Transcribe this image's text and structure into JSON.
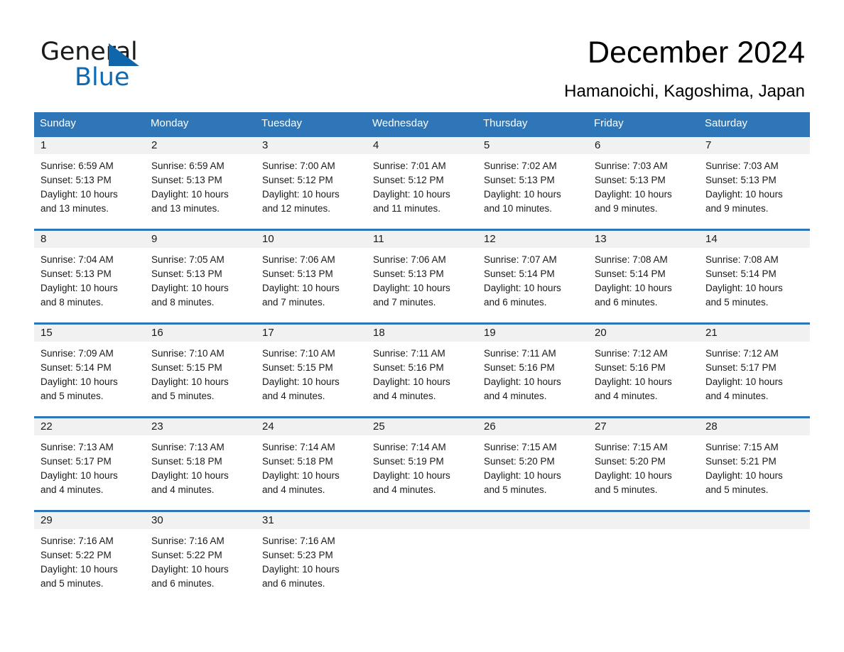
{
  "brand": {
    "word1": "General",
    "word2": "Blue",
    "triangle_color": "#1066ab",
    "blue_text_color": "#0d6ab5"
  },
  "header": {
    "title": "December 2024",
    "subtitle": "Hamanoichi, Kagoshima, Japan",
    "header_bg": "#2e76b8",
    "day_band_bg": "#f1f1f1"
  },
  "weekdays": [
    "Sunday",
    "Monday",
    "Tuesday",
    "Wednesday",
    "Thursday",
    "Friday",
    "Saturday"
  ],
  "weeks": [
    [
      {
        "day": "1",
        "sunrise": "Sunrise: 6:59 AM",
        "sunset": "Sunset: 5:13 PM",
        "daylight1": "Daylight: 10 hours",
        "daylight2": "and 13 minutes."
      },
      {
        "day": "2",
        "sunrise": "Sunrise: 6:59 AM",
        "sunset": "Sunset: 5:13 PM",
        "daylight1": "Daylight: 10 hours",
        "daylight2": "and 13 minutes."
      },
      {
        "day": "3",
        "sunrise": "Sunrise: 7:00 AM",
        "sunset": "Sunset: 5:12 PM",
        "daylight1": "Daylight: 10 hours",
        "daylight2": "and 12 minutes."
      },
      {
        "day": "4",
        "sunrise": "Sunrise: 7:01 AM",
        "sunset": "Sunset: 5:12 PM",
        "daylight1": "Daylight: 10 hours",
        "daylight2": "and 11 minutes."
      },
      {
        "day": "5",
        "sunrise": "Sunrise: 7:02 AM",
        "sunset": "Sunset: 5:13 PM",
        "daylight1": "Daylight: 10 hours",
        "daylight2": "and 10 minutes."
      },
      {
        "day": "6",
        "sunrise": "Sunrise: 7:03 AM",
        "sunset": "Sunset: 5:13 PM",
        "daylight1": "Daylight: 10 hours",
        "daylight2": "and 9 minutes."
      },
      {
        "day": "7",
        "sunrise": "Sunrise: 7:03 AM",
        "sunset": "Sunset: 5:13 PM",
        "daylight1": "Daylight: 10 hours",
        "daylight2": "and 9 minutes."
      }
    ],
    [
      {
        "day": "8",
        "sunrise": "Sunrise: 7:04 AM",
        "sunset": "Sunset: 5:13 PM",
        "daylight1": "Daylight: 10 hours",
        "daylight2": "and 8 minutes."
      },
      {
        "day": "9",
        "sunrise": "Sunrise: 7:05 AM",
        "sunset": "Sunset: 5:13 PM",
        "daylight1": "Daylight: 10 hours",
        "daylight2": "and 8 minutes."
      },
      {
        "day": "10",
        "sunrise": "Sunrise: 7:06 AM",
        "sunset": "Sunset: 5:13 PM",
        "daylight1": "Daylight: 10 hours",
        "daylight2": "and 7 minutes."
      },
      {
        "day": "11",
        "sunrise": "Sunrise: 7:06 AM",
        "sunset": "Sunset: 5:13 PM",
        "daylight1": "Daylight: 10 hours",
        "daylight2": "and 7 minutes."
      },
      {
        "day": "12",
        "sunrise": "Sunrise: 7:07 AM",
        "sunset": "Sunset: 5:14 PM",
        "daylight1": "Daylight: 10 hours",
        "daylight2": "and 6 minutes."
      },
      {
        "day": "13",
        "sunrise": "Sunrise: 7:08 AM",
        "sunset": "Sunset: 5:14 PM",
        "daylight1": "Daylight: 10 hours",
        "daylight2": "and 6 minutes."
      },
      {
        "day": "14",
        "sunrise": "Sunrise: 7:08 AM",
        "sunset": "Sunset: 5:14 PM",
        "daylight1": "Daylight: 10 hours",
        "daylight2": "and 5 minutes."
      }
    ],
    [
      {
        "day": "15",
        "sunrise": "Sunrise: 7:09 AM",
        "sunset": "Sunset: 5:14 PM",
        "daylight1": "Daylight: 10 hours",
        "daylight2": "and 5 minutes."
      },
      {
        "day": "16",
        "sunrise": "Sunrise: 7:10 AM",
        "sunset": "Sunset: 5:15 PM",
        "daylight1": "Daylight: 10 hours",
        "daylight2": "and 5 minutes."
      },
      {
        "day": "17",
        "sunrise": "Sunrise: 7:10 AM",
        "sunset": "Sunset: 5:15 PM",
        "daylight1": "Daylight: 10 hours",
        "daylight2": "and 4 minutes."
      },
      {
        "day": "18",
        "sunrise": "Sunrise: 7:11 AM",
        "sunset": "Sunset: 5:16 PM",
        "daylight1": "Daylight: 10 hours",
        "daylight2": "and 4 minutes."
      },
      {
        "day": "19",
        "sunrise": "Sunrise: 7:11 AM",
        "sunset": "Sunset: 5:16 PM",
        "daylight1": "Daylight: 10 hours",
        "daylight2": "and 4 minutes."
      },
      {
        "day": "20",
        "sunrise": "Sunrise: 7:12 AM",
        "sunset": "Sunset: 5:16 PM",
        "daylight1": "Daylight: 10 hours",
        "daylight2": "and 4 minutes."
      },
      {
        "day": "21",
        "sunrise": "Sunrise: 7:12 AM",
        "sunset": "Sunset: 5:17 PM",
        "daylight1": "Daylight: 10 hours",
        "daylight2": "and 4 minutes."
      }
    ],
    [
      {
        "day": "22",
        "sunrise": "Sunrise: 7:13 AM",
        "sunset": "Sunset: 5:17 PM",
        "daylight1": "Daylight: 10 hours",
        "daylight2": "and 4 minutes."
      },
      {
        "day": "23",
        "sunrise": "Sunrise: 7:13 AM",
        "sunset": "Sunset: 5:18 PM",
        "daylight1": "Daylight: 10 hours",
        "daylight2": "and 4 minutes."
      },
      {
        "day": "24",
        "sunrise": "Sunrise: 7:14 AM",
        "sunset": "Sunset: 5:18 PM",
        "daylight1": "Daylight: 10 hours",
        "daylight2": "and 4 minutes."
      },
      {
        "day": "25",
        "sunrise": "Sunrise: 7:14 AM",
        "sunset": "Sunset: 5:19 PM",
        "daylight1": "Daylight: 10 hours",
        "daylight2": "and 4 minutes."
      },
      {
        "day": "26",
        "sunrise": "Sunrise: 7:15 AM",
        "sunset": "Sunset: 5:20 PM",
        "daylight1": "Daylight: 10 hours",
        "daylight2": "and 5 minutes."
      },
      {
        "day": "27",
        "sunrise": "Sunrise: 7:15 AM",
        "sunset": "Sunset: 5:20 PM",
        "daylight1": "Daylight: 10 hours",
        "daylight2": "and 5 minutes."
      },
      {
        "day": "28",
        "sunrise": "Sunrise: 7:15 AM",
        "sunset": "Sunset: 5:21 PM",
        "daylight1": "Daylight: 10 hours",
        "daylight2": "and 5 minutes."
      }
    ],
    [
      {
        "day": "29",
        "sunrise": "Sunrise: 7:16 AM",
        "sunset": "Sunset: 5:22 PM",
        "daylight1": "Daylight: 10 hours",
        "daylight2": "and 5 minutes."
      },
      {
        "day": "30",
        "sunrise": "Sunrise: 7:16 AM",
        "sunset": "Sunset: 5:22 PM",
        "daylight1": "Daylight: 10 hours",
        "daylight2": "and 6 minutes."
      },
      {
        "day": "31",
        "sunrise": "Sunrise: 7:16 AM",
        "sunset": "Sunset: 5:23 PM",
        "daylight1": "Daylight: 10 hours",
        "daylight2": "and 6 minutes."
      },
      {
        "day": "",
        "sunrise": "",
        "sunset": "",
        "daylight1": "",
        "daylight2": ""
      },
      {
        "day": "",
        "sunrise": "",
        "sunset": "",
        "daylight1": "",
        "daylight2": ""
      },
      {
        "day": "",
        "sunrise": "",
        "sunset": "",
        "daylight1": "",
        "daylight2": ""
      },
      {
        "day": "",
        "sunrise": "",
        "sunset": "",
        "daylight1": "",
        "daylight2": ""
      }
    ]
  ]
}
